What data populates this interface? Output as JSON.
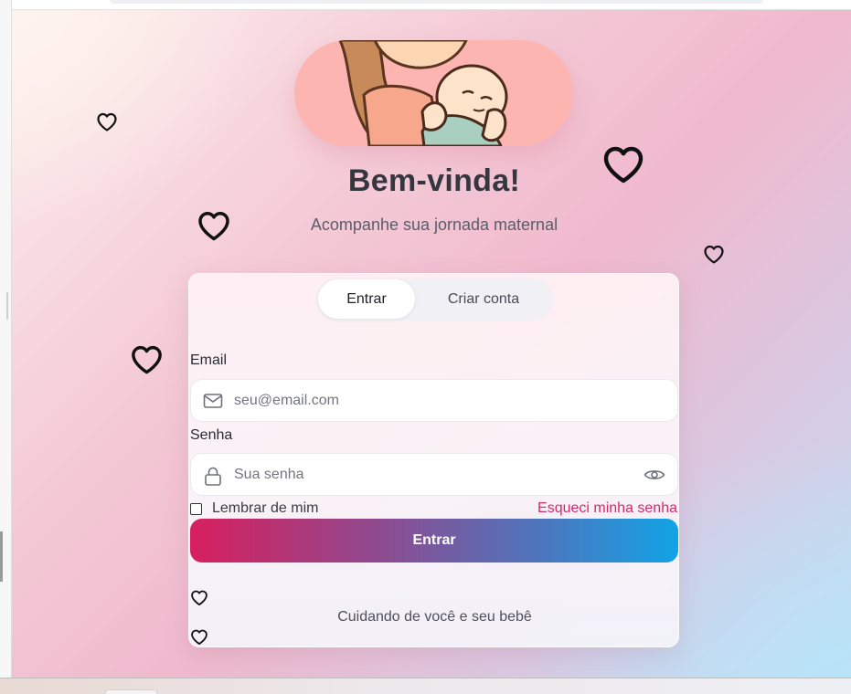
{
  "colors": {
    "accent_pink": "#d42a6c",
    "gradient_start": "#d81f5d",
    "gradient_end": "#12a3e6",
    "hero_background": "#fdb5b2",
    "title": "#353740"
  },
  "header": {
    "title": "Bem-vinda!",
    "subtitle": "Acompanhe sua jornada maternal",
    "hero_icon": "mother-and-baby-illustration"
  },
  "tabs": [
    {
      "label": "Entrar",
      "active": true
    },
    {
      "label": "Criar conta",
      "active": false
    }
  ],
  "form": {
    "email_label": "Email",
    "email_placeholder": "seu@email.com",
    "email_value": "",
    "email_icon": "mail-icon",
    "password_label": "Senha",
    "password_placeholder": "Sua senha",
    "password_value": "",
    "password_icon": "lock-icon",
    "password_toggle_icon": "eye-icon",
    "remember_label": "Lembrar de mim",
    "remember_checked": false,
    "forgot_link": "Esqueci minha senha",
    "submit_label": "Entrar"
  },
  "footer": {
    "text": "Cuidando de você e seu bebê",
    "icon": "heart-icon"
  },
  "decorations": {
    "icon": "heart-icon"
  }
}
